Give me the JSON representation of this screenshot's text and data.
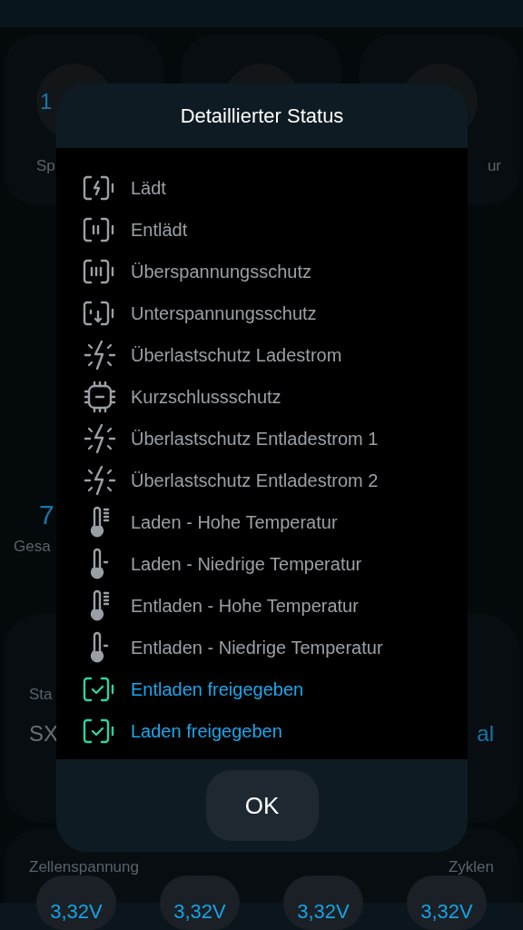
{
  "background": {
    "top_value": "1",
    "top_label_left": "Sp",
    "top_label_right": "ur",
    "total_value": "7",
    "total_label": "Gesa",
    "status_label": "Sta",
    "status_value": "SX",
    "status_right": "al",
    "cell_label": "Zellenspannung",
    "cycles_label": "Zyklen",
    "cells": [
      "3,32V",
      "3,32V",
      "3,32V",
      "3,32V"
    ]
  },
  "dialog": {
    "title": "Detaillierter Status",
    "items": [
      {
        "kind": "charging",
        "label": "Lädt",
        "active": false
      },
      {
        "kind": "discharging",
        "label": "Entlädt",
        "active": false
      },
      {
        "kind": "overvoltage",
        "label": "Überspannungsschutz",
        "active": false
      },
      {
        "kind": "undervoltage",
        "label": "Unterspannungsschutz",
        "active": false
      },
      {
        "kind": "overload",
        "label": "Überlastschutz Ladestrom",
        "active": false
      },
      {
        "kind": "chip",
        "label": "Kurzschlussschutz",
        "active": false
      },
      {
        "kind": "overload",
        "label": "Überlastschutz Entladestrom 1",
        "active": false
      },
      {
        "kind": "overload",
        "label": "Überlastschutz Entladestrom 2",
        "active": false
      },
      {
        "kind": "temp-high",
        "label": "Laden - Hohe Temperatur",
        "active": false
      },
      {
        "kind": "temp-low",
        "label": "Laden - Niedrige Temperatur",
        "active": false
      },
      {
        "kind": "temp-high",
        "label": "Entladen - Hohe Temperatur",
        "active": false
      },
      {
        "kind": "temp-low",
        "label": "Entladen - Niedrige Temperatur",
        "active": false
      },
      {
        "kind": "check",
        "label": "Entladen freigegeben",
        "active": true
      },
      {
        "kind": "check",
        "label": "Laden freigegeben",
        "active": true
      }
    ],
    "button": "OK"
  }
}
